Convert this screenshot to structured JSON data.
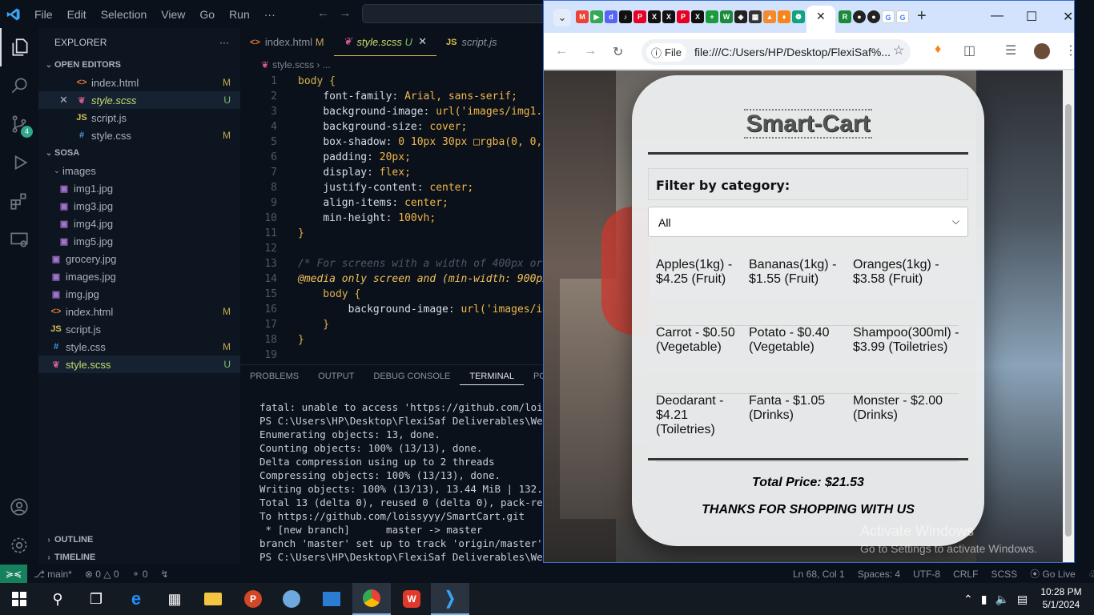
{
  "vscode": {
    "menu": [
      "File",
      "Edit",
      "Selection",
      "View",
      "Go",
      "Run",
      "···"
    ],
    "explorer_title": "EXPLORER",
    "open_editors_title": "OPEN EDITORS",
    "open_editors": [
      {
        "name": "index.html",
        "type": "html",
        "status": "M"
      },
      {
        "name": "style.scss",
        "type": "scss",
        "status": "U"
      },
      {
        "name": "script.js",
        "type": "js",
        "status": ""
      },
      {
        "name": "style.css",
        "type": "css",
        "status": "M"
      }
    ],
    "folder_title": "SOSA",
    "images_folder": "images",
    "images": [
      "img1.jpg",
      "img3.jpg",
      "img4.jpg",
      "img5.jpg"
    ],
    "files": [
      {
        "name": "grocery.jpg",
        "type": "img",
        "status": ""
      },
      {
        "name": "images.jpg",
        "type": "img",
        "status": ""
      },
      {
        "name": "img.jpg",
        "type": "img",
        "status": ""
      },
      {
        "name": "index.html",
        "type": "html",
        "status": "M"
      },
      {
        "name": "script.js",
        "type": "js",
        "status": ""
      },
      {
        "name": "style.css",
        "type": "css",
        "status": "M"
      },
      {
        "name": "style.scss",
        "type": "scss",
        "status": "U"
      }
    ],
    "outline_title": "OUTLINE",
    "timeline_title": "TIMELINE",
    "tabs": [
      {
        "label": "index.html",
        "status": "M"
      },
      {
        "label": "style.scss",
        "status": "U"
      },
      {
        "label": "script.js",
        "status": ""
      }
    ],
    "breadcrumb": "style.scss",
    "breadcrumb_more": "...",
    "code_lines": [
      "body {",
      "    font-family: Arial, sans-serif;",
      "    background-image: url('images/img1.j",
      "    background-size: cover;",
      "    box-shadow: 0 10px 30px □rgba(0, 0,",
      "    padding: 20px;",
      "    display: flex;",
      "    justify-content: center;",
      "    align-items: center;",
      "    min-height: 100vh;",
      "}",
      "",
      "/* For screens with a width of 400px or",
      "@media only screen and (min-width: 900px",
      "    body {",
      "        background-image: url('images/im",
      "    }",
      "}",
      ""
    ],
    "panel_tabs": [
      "PROBLEMS",
      "OUTPUT",
      "DEBUG CONSOLE",
      "TERMINAL",
      "PORT"
    ],
    "terminal": [
      "fatal: unable to access 'https://github.com/loissyy",
      "PS C:\\Users\\HP\\Desktop\\FlexiSaf Deliverables\\Week 1",
      "Enumerating objects: 13, done.",
      "Counting objects: 100% (13/13), done.",
      "Delta compression using up to 2 threads",
      "Compressing objects: 100% (13/13), done.",
      "Writing objects: 100% (13/13), 13.44 MiB | 132.00 K",
      "Total 13 (delta 0), reused 0 (delta 0), pack-reuse",
      "To https://github.com/loissyyy/SmartCart.git",
      " * [new branch]      master -> master",
      "branch 'master' set up to track 'origin/master'.",
      "PS C:\\Users\\HP\\Desktop\\FlexiSaf Deliverables\\Week 1"
    ],
    "scm_badge": "4",
    "status": {
      "branch": "main*",
      "errors": "0",
      "warnings": "0",
      "info": "0",
      "position": "Ln 68, Col 1",
      "spaces": "Spaces: 4",
      "encoding": "UTF-8",
      "eol": "CRLF",
      "language": "SCSS",
      "golive": "Go Live"
    }
  },
  "chrome": {
    "url_chip": "File",
    "url": "file:///C:/Users/HP/Desktop/FlexiSaf%...",
    "new_tab": "+"
  },
  "app": {
    "title": "Smart-Cart",
    "filter_label": "Filter by category:",
    "select_value": "All",
    "products": [
      [
        "Apples(1kg) - $4.25 (Fruit)",
        "Bananas(1kg) - $1.55 (Fruit)",
        "Oranges(1kg) - $3.58 (Fruit)"
      ],
      [
        "Carrot - $0.50 (Vegetable)",
        "Potato - $0.40 (Vegetable)",
        "Shampoo(300ml) - $3.99 (Toiletries)"
      ],
      [
        "Deodarant - $4.21 (Toiletries)",
        "Fanta - $1.05 (Drinks)",
        "Monster - $2.00 (Drinks)"
      ]
    ],
    "total": "Total Price: $21.53",
    "thanks": "THANKS FOR SHOPPING WITH US"
  },
  "watermark": {
    "line1": "Activate Windows",
    "line2": "Go to Settings to activate Windows."
  },
  "taskbar": {
    "time": "10:28 PM",
    "date": "5/1/2024"
  }
}
